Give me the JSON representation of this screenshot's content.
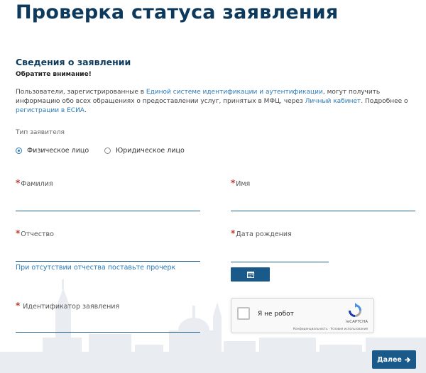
{
  "page": {
    "title": "Проверка статуса заявления"
  },
  "section": {
    "title": "Сведения о заявлении",
    "notice": "Обратите внимание!",
    "info": {
      "part1": "Пользователи, зарегистрированные в ",
      "link_esia": "Единой системе идентификации и аутентификации",
      "part2": ", могут получить информацию обо всех обращениях о предоставлении услуг, принятых в МФЦ, через ",
      "link_cabinet": "Личный кабинет",
      "part3": ". Подробнее о ",
      "link_reg": "регистрации в ЕСИА",
      "part4": "."
    }
  },
  "applicant_type": {
    "label": "Тип заявителя",
    "options": [
      {
        "label": "Физическое лицо",
        "selected": true
      },
      {
        "label": "Юридическое лицо",
        "selected": false
      }
    ]
  },
  "form": {
    "required_mark": "*",
    "last_name": {
      "label": "Фамилия",
      "value": ""
    },
    "first_name": {
      "label": "Имя",
      "value": ""
    },
    "patronymic": {
      "label": "Отчество",
      "value": "",
      "hint": "При отсутствии отчества поставьте прочерк"
    },
    "birth_date": {
      "label": "Дата рождения",
      "value": ""
    },
    "application_id": {
      "label": " Идентификатор заявления",
      "value": ""
    }
  },
  "captcha": {
    "label": "Я не робот",
    "brand": "reCAPTCHA",
    "terms": "Конфиденциальность · Условия использования"
  },
  "buttons": {
    "next": "Далее"
  },
  "icons": {
    "calendar": "calendar-icon",
    "arrow": "arrow-right-icon",
    "recaptcha": "recaptcha-logo-icon"
  },
  "colors": {
    "title": "#0d3a5c",
    "accent": "#1a5a8a",
    "link": "#2a7ab8",
    "required": "#c0392b"
  }
}
